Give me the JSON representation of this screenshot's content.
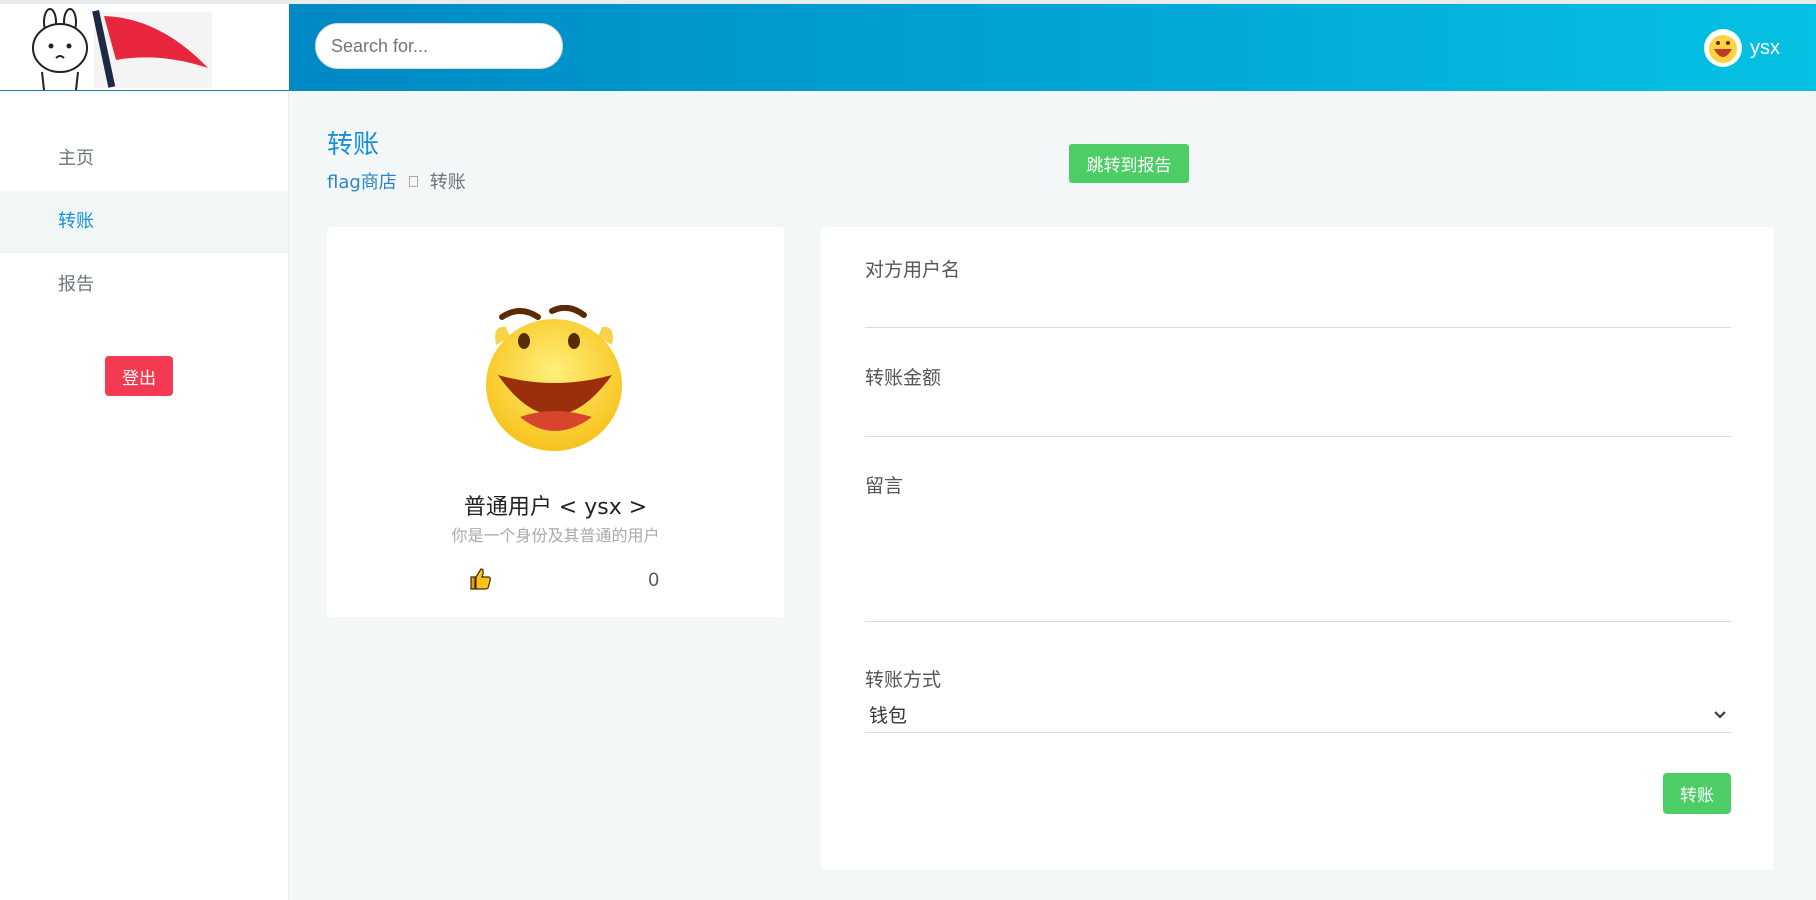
{
  "header": {
    "search_placeholder": "Search for...",
    "username": "ysx"
  },
  "sidebar": {
    "items": [
      {
        "label": "主页",
        "active": false
      },
      {
        "label": "转账",
        "active": true
      },
      {
        "label": "报告",
        "active": false
      }
    ],
    "logout_label": "登出"
  },
  "page": {
    "title": "转账",
    "breadcrumb": [
      "flag商店",
      "转账"
    ],
    "jump_button": "跳转到报告"
  },
  "profile": {
    "name": "普通用户 < ysx >",
    "description": "你是一个身份及其普通的用户",
    "likes": "0",
    "like_icon": "thumbs-up-icon"
  },
  "form": {
    "recipient_label": "对方用户名",
    "recipient_value": "",
    "amount_label": "转账金额",
    "amount_value": "",
    "message_label": "留言",
    "message_value": "",
    "method_label": "转账方式",
    "method_value": "钱包",
    "submit_label": "转账"
  },
  "colors": {
    "accent": "#1a8fd8",
    "success": "#4ccd66",
    "danger": "#f23a52",
    "header_start": "#0089c4",
    "header_end": "#05c1e3"
  }
}
